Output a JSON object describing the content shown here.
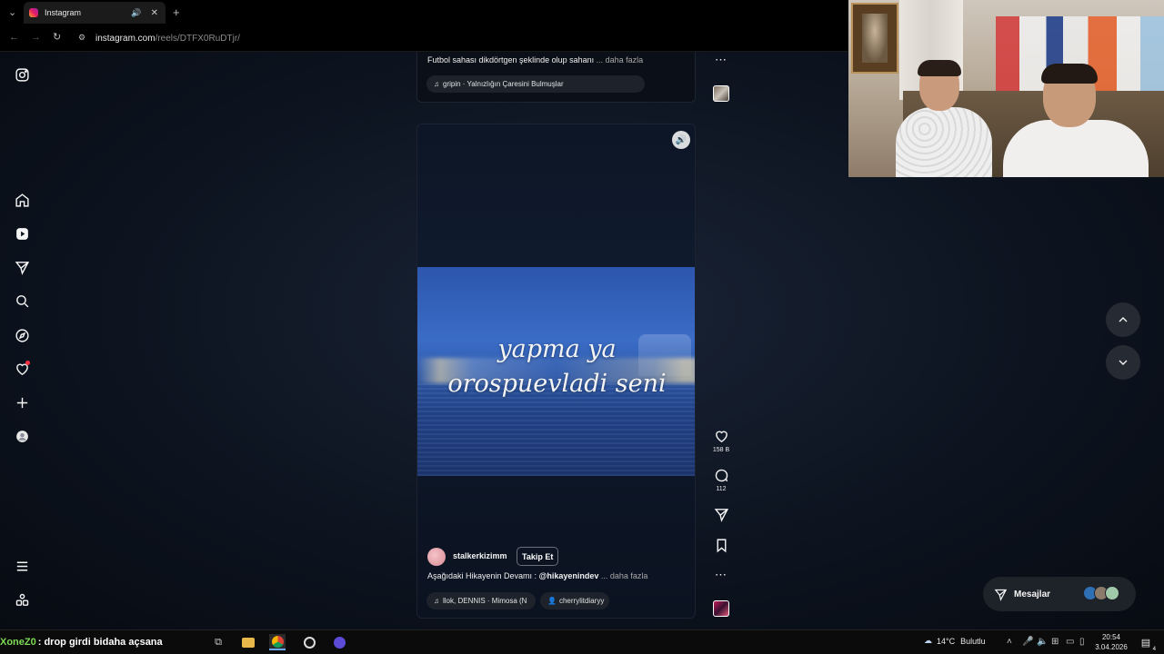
{
  "browser": {
    "tab_title": "Instagram",
    "url_host": "instagram.com",
    "url_path": "/reels/DTFX0RuDTjr/"
  },
  "previous_reel": {
    "caption_text": "Futbol sahası dikdörtgen şeklinde olup sahanı",
    "more_label": "... daha fazla",
    "music_label": "gripin · Yalnızlığın Çaresini Bulmuşlar"
  },
  "reel": {
    "overlay_line1": "yapma ya",
    "overlay_line2": "orospuevladi seni",
    "username": "stalkerkizimm",
    "follow_label": "Takip Et",
    "caption_text": "Aşağıdaki Hikayenin Devamı : ",
    "caption_tag": "@hikayenindev",
    "more_label": "... daha fazla",
    "music_label": "llok, DENNIS · Mimosa (N",
    "tagged_user": "cherrylitdiaryy",
    "likes": "158 B",
    "comments": "112"
  },
  "messages": {
    "label": "Mesajlar"
  },
  "taskbar": {
    "ticker_brand": "XoneZ0",
    "ticker_text": ": drop girdi bidaha açsana",
    "temperature": "14°C",
    "weather": "Bulutlu",
    "time": "20:54",
    "date": "3.04.2026",
    "notification_count": "4"
  },
  "colors": {
    "page_bg": "#0d1420",
    "accent_red": "#ff3040",
    "video_blue": "#3a6cc6"
  }
}
